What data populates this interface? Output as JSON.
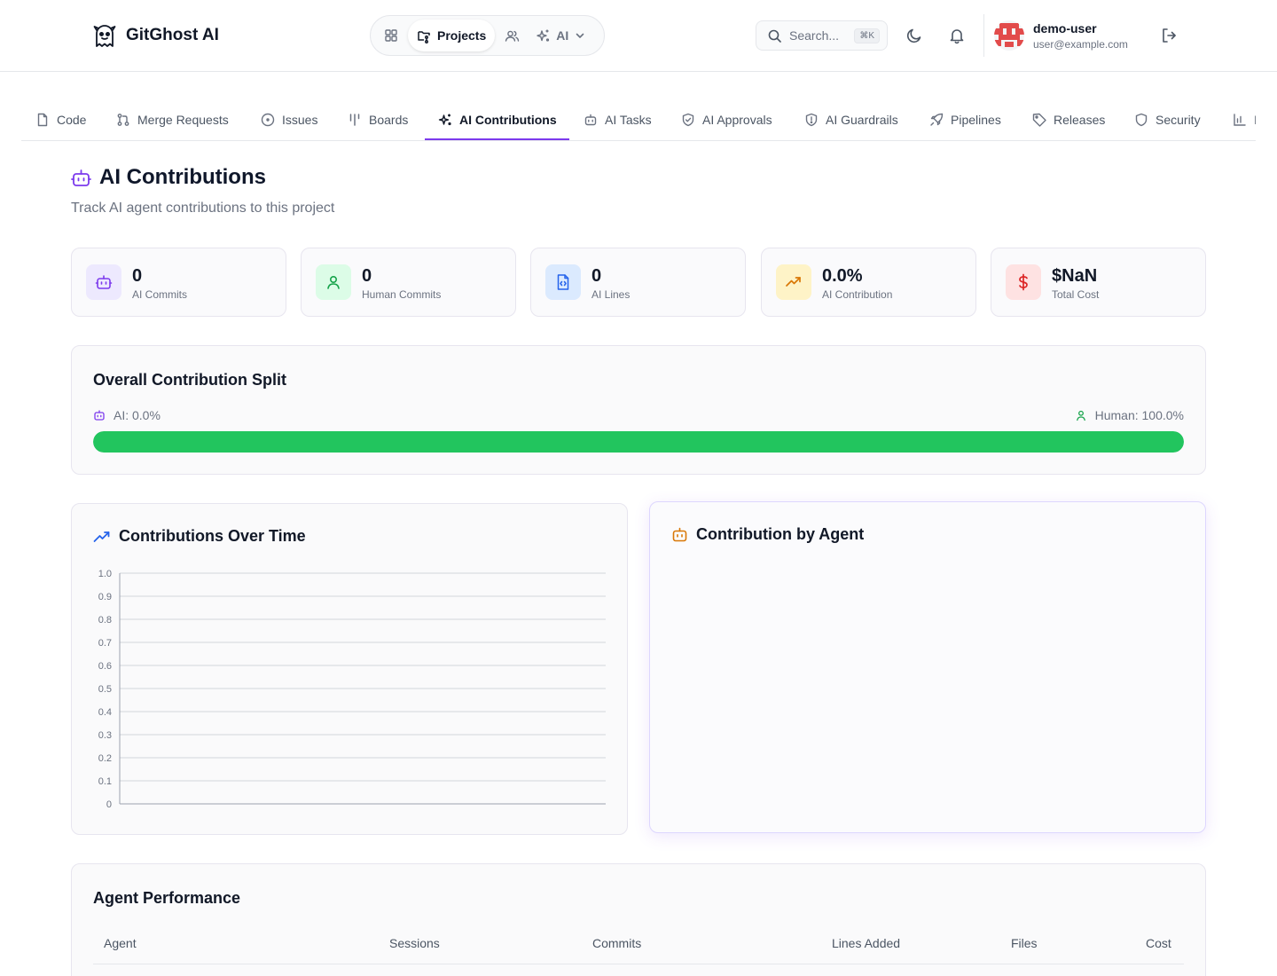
{
  "app": {
    "name": "GitGhost AI"
  },
  "nav": {
    "projects_label": "Projects",
    "ai_label": "AI"
  },
  "search": {
    "placeholder": "Search...",
    "shortcut": "⌘K"
  },
  "user": {
    "name": "demo-user",
    "email": "user@example.com"
  },
  "tabs": [
    {
      "label": "Code",
      "icon": "file-icon"
    },
    {
      "label": "Merge Requests",
      "icon": "git-pull-request-icon"
    },
    {
      "label": "Issues",
      "icon": "circle-dot-icon"
    },
    {
      "label": "Boards",
      "icon": "kanban-icon"
    },
    {
      "label": "AI Contributions",
      "icon": "sparkles-icon",
      "active": true
    },
    {
      "label": "AI Tasks",
      "icon": "bot-icon"
    },
    {
      "label": "AI Approvals",
      "icon": "shield-check-icon"
    },
    {
      "label": "AI Guardrails",
      "icon": "shield-alert-icon"
    },
    {
      "label": "Pipelines",
      "icon": "rocket-icon"
    },
    {
      "label": "Releases",
      "icon": "tag-icon"
    },
    {
      "label": "Security",
      "icon": "shield-icon"
    },
    {
      "label": "I",
      "icon": "bar-chart-icon"
    }
  ],
  "page": {
    "title": "AI Contributions",
    "subtitle": "Track AI agent contributions to this project"
  },
  "stats": [
    {
      "value": "0",
      "label": "AI Commits",
      "icon": "bot-icon",
      "color": "#7c3aed",
      "bg": "#ede9fe"
    },
    {
      "value": "0",
      "label": "Human Commits",
      "icon": "user-icon",
      "color": "#16a34a",
      "bg": "#dcfce7"
    },
    {
      "value": "0",
      "label": "AI Lines",
      "icon": "file-code-icon",
      "color": "#2563eb",
      "bg": "#dbeafe"
    },
    {
      "value": "0.0%",
      "label": "AI Contribution",
      "icon": "trending-up-icon",
      "color": "#d97706",
      "bg": "#fef3c7"
    },
    {
      "value": "$NaN",
      "label": "Total Cost",
      "icon": "dollar-icon",
      "color": "#dc2626",
      "bg": "#fee2e2"
    }
  ],
  "split": {
    "title": "Overall Contribution Split",
    "ai_label": "AI: 0.0%",
    "human_label": "Human: 100.0%",
    "ai_fraction": 0.0,
    "human_fraction": 1.0,
    "ai_color": "#8b5cf6",
    "human_color": "#22c55e"
  },
  "contributions_over_time": {
    "title": "Contributions Over Time",
    "chart_data": {
      "type": "line",
      "x": [],
      "series": [],
      "ylim": [
        0,
        1.0
      ],
      "yticks": [
        "0",
        "0.1",
        "0.2",
        "0.3",
        "0.4",
        "0.5",
        "0.6",
        "0.7",
        "0.8",
        "0.9",
        "1.0"
      ],
      "grid": true
    }
  },
  "contribution_by_agent": {
    "title": "Contribution by Agent"
  },
  "agent_performance": {
    "title": "Agent Performance",
    "columns": [
      "Agent",
      "Sessions",
      "Commits",
      "Lines Added",
      "Files",
      "Cost"
    ],
    "rows": []
  }
}
